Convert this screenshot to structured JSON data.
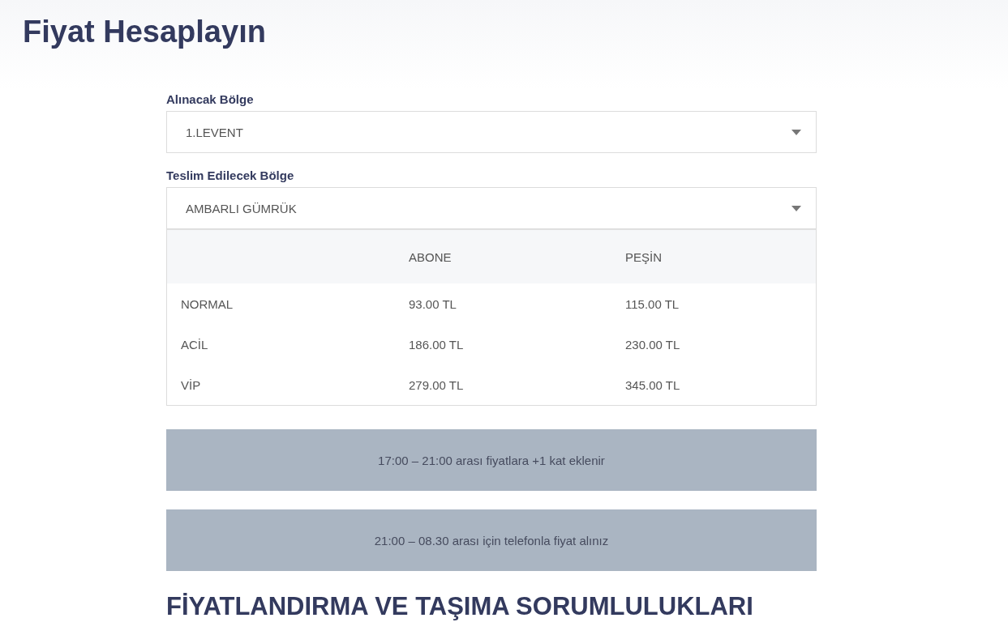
{
  "title": "Fiyat Hesaplayın",
  "fields": [
    {
      "label": "Alınacak Bölge",
      "value": "1.LEVENT"
    },
    {
      "label": "Teslim Edilecek Bölge",
      "value": "AMBARLI GÜMRÜK"
    }
  ],
  "table": {
    "columns": [
      "ABONE",
      "PEŞİN"
    ],
    "rows": [
      {
        "name": "NORMAL",
        "cells": [
          "93.00 TL",
          "115.00 TL"
        ]
      },
      {
        "name": "ACİL",
        "cells": [
          "186.00 TL",
          "230.00 TL"
        ]
      },
      {
        "name": "VİP",
        "cells": [
          "279.00 TL",
          "345.00 TL"
        ]
      }
    ]
  },
  "notices": [
    "17:00 – 21:00 arası fiyatlara +1 kat eklenir",
    "21:00 – 08.30 arası için telefonla fiyat alınız"
  ],
  "section_heading": "FİYATLANDIRMA VE TAŞIMA SORUMLULUKLARI"
}
